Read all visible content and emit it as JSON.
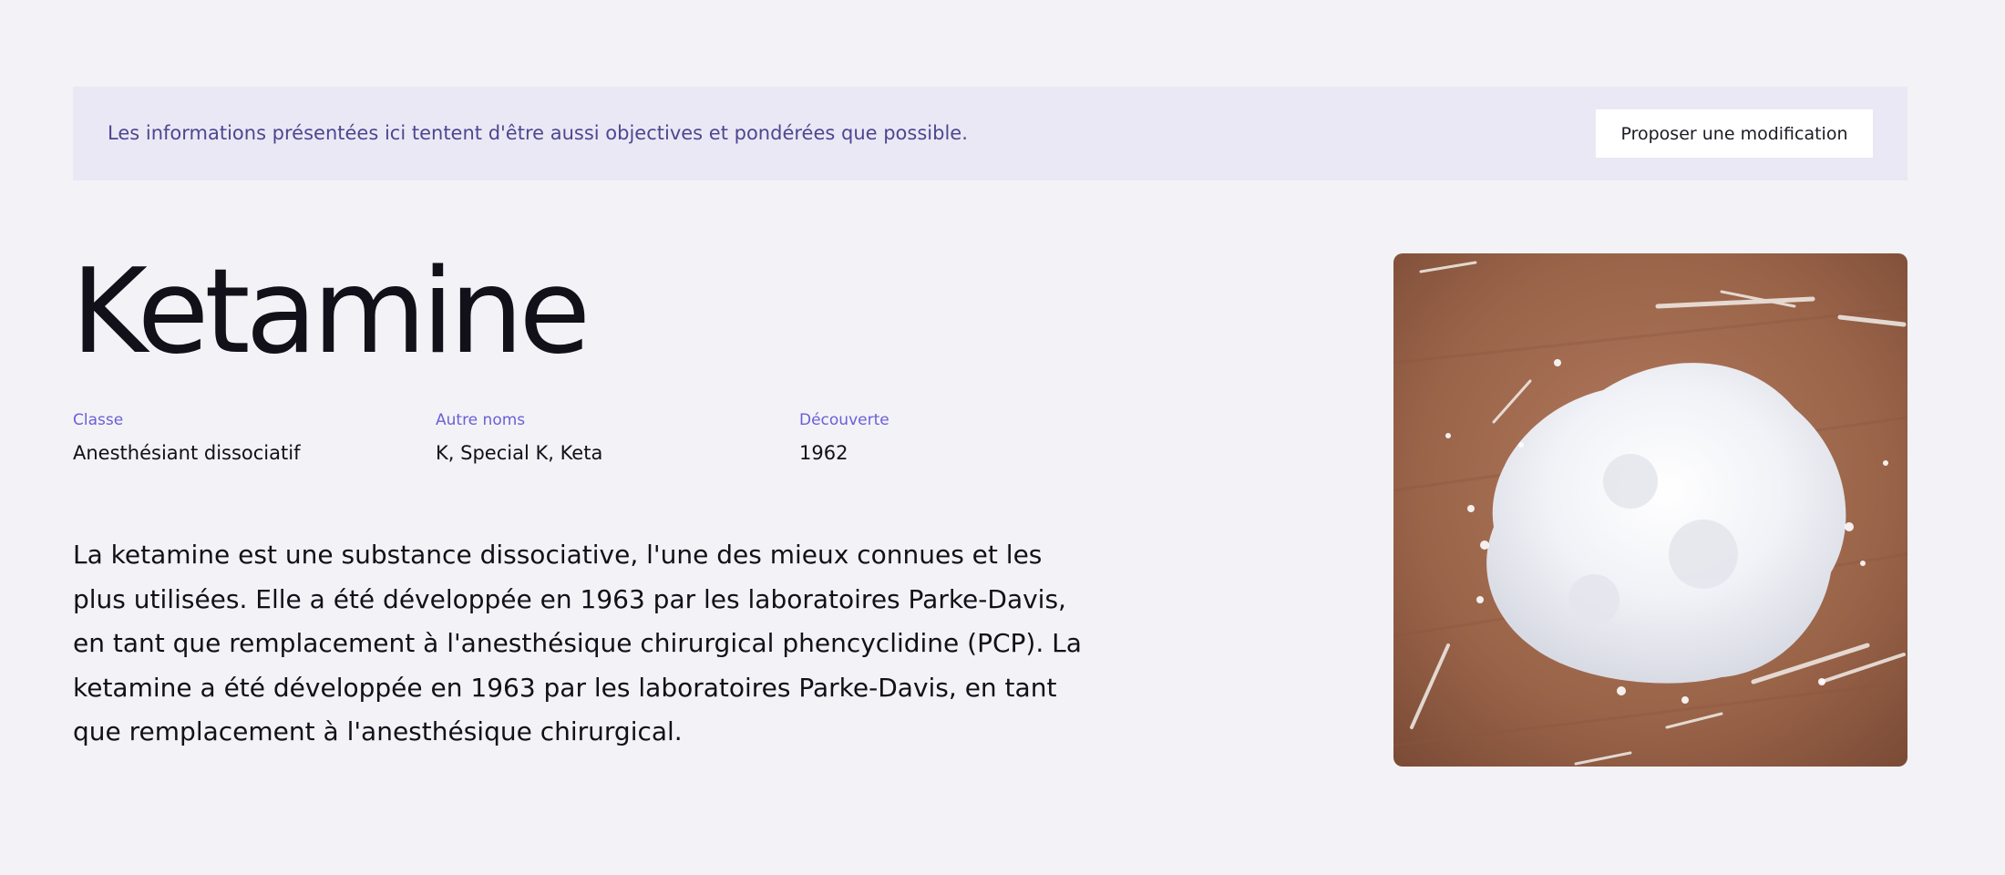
{
  "banner": {
    "text": "Les informations présentées ici tentent d'être aussi objectives et pondérées que possible.",
    "button_label": "Proposer une modification"
  },
  "substance": {
    "name": "Ketamine",
    "meta": [
      {
        "label": "Classe",
        "value": "Anesthésiant dissociatif"
      },
      {
        "label": "Autre noms",
        "value": "K, Special K, Keta"
      },
      {
        "label": "Découverte",
        "value": "1962"
      }
    ],
    "description": "La ketamine est une substance dissociative, l'une des mieux connues et les plus utilisées. Elle a été développée en 1963 par les laboratoires Parke-Davis, en tant que remplacement à l'anesthésique chirurgical phencyclidine (PCP). La ketamine a été développée en 1963 par les laboratoires Parke-Davis, en tant que remplacement à l'anesthésique chirurgical."
  },
  "colors": {
    "page_background": "#f3f2f6",
    "banner_background": "#ebe8f5",
    "banner_text": "#4c4790",
    "accent_label": "#6b5fd6",
    "text_primary": "#121019"
  },
  "image": {
    "subject": "white crystalline powder pile on a brown wooden surface"
  }
}
